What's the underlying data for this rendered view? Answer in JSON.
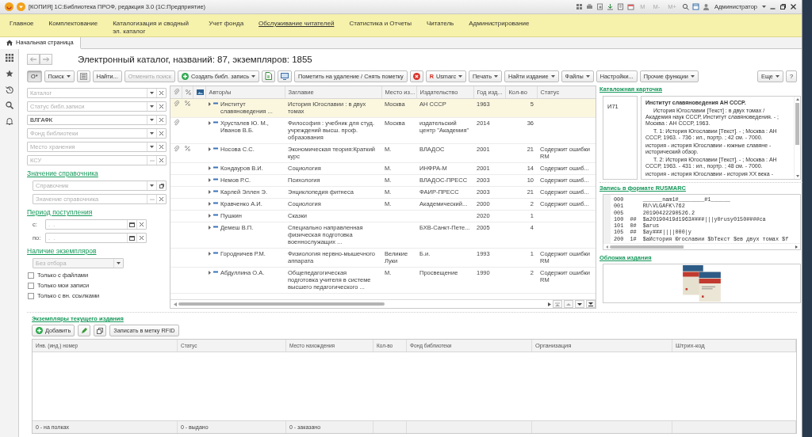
{
  "window": {
    "title": "[КОПИЯ] 1С:Библиотека ПРОФ, редакция 3.0 (1С:Предприятие)",
    "memory_buttons": [
      "M",
      "M-",
      "M+"
    ],
    "user": "Администратор"
  },
  "menu": [
    {
      "label": "Главное",
      "selected": false
    },
    {
      "label": "Комплектование",
      "selected": false
    },
    {
      "label": "Каталогизация и сводный эл. каталог",
      "selected": false
    },
    {
      "label": "Учет фонда",
      "selected": false
    },
    {
      "label": "Обслуживание читателей",
      "selected": true
    },
    {
      "label": "Статистика и Отчеты",
      "selected": false
    },
    {
      "label": "Читатель",
      "selected": false
    },
    {
      "label": "Администрирование",
      "selected": false
    }
  ],
  "tabs": [
    {
      "label": "Начальная страница",
      "selected": true
    }
  ],
  "catalog": {
    "title": "Электронный каталог, названий: 87, экземпляров: 1855"
  },
  "toolbar": [
    {
      "kind": "button",
      "label": "О*",
      "dropdown": false,
      "disabled": false,
      "pressed": true
    },
    {
      "kind": "button",
      "label": "Поиск",
      "dropdown": true,
      "disabled": false,
      "pressed": false
    },
    {
      "kind": "icon"
    },
    {
      "kind": "button",
      "label": "Найти...",
      "dropdown": false,
      "disabled": false,
      "pressed": false
    },
    {
      "kind": "button",
      "label": "Отменить поиск",
      "dropdown": false,
      "disabled": true,
      "pressed": false
    },
    {
      "kind": "create",
      "label": "Создать библ. запись",
      "dropdown": true,
      "disabled": false,
      "pressed": false
    },
    {
      "kind": "icon"
    },
    {
      "kind": "icon"
    },
    {
      "kind": "button",
      "label": "Пометить на удаление / Снять пометку",
      "dropdown": false,
      "disabled": false,
      "pressed": false
    },
    {
      "kind": "icon"
    },
    {
      "kind": "button",
      "badge": "R",
      "label": "Usmarc",
      "dropdown": true,
      "disabled": false,
      "pressed": false
    },
    {
      "kind": "button",
      "label": "Печать",
      "dropdown": true,
      "disabled": false,
      "pressed": false
    },
    {
      "kind": "button",
      "label": "Найти издание",
      "dropdown": true,
      "disabled": false,
      "pressed": false
    },
    {
      "kind": "button",
      "label": "Файлы",
      "dropdown": true,
      "disabled": false,
      "pressed": false
    },
    {
      "kind": "button",
      "label": "Настройки...",
      "dropdown": false,
      "disabled": false,
      "pressed": false
    },
    {
      "kind": "button",
      "label": "Прочие функции",
      "dropdown": true,
      "disabled": false,
      "pressed": false
    }
  ],
  "toolbar_right": [
    {
      "label": "Еще",
      "dropdown": true
    },
    {
      "label": "?",
      "dropdown": false
    }
  ],
  "filters": {
    "fields": [
      {
        "kind": "select",
        "placeholder": "Каталог"
      },
      {
        "kind": "select",
        "placeholder": "Статус библ.записи"
      },
      {
        "kind": "select",
        "value": "ВЛГАФК"
      },
      {
        "kind": "select",
        "placeholder": "Фонд библиотеки"
      },
      {
        "kind": "select",
        "placeholder": "Место хранения"
      },
      {
        "kind": "choice",
        "placeholder": "КСУ"
      }
    ],
    "groups": [
      {
        "title": "Значение справочника",
        "fields": [
          {
            "kind": "reference",
            "placeholder": "Справочник"
          },
          {
            "kind": "choice",
            "placeholder": "Значение справочника"
          }
        ]
      },
      {
        "title": "Период поступления",
        "fields": [
          {
            "kind": "date",
            "label": "с:",
            "placeholder": ".  ."
          },
          {
            "kind": "date",
            "label": "по:",
            "placeholder": ".  ."
          }
        ]
      },
      {
        "title": "Наличие экземпляров",
        "fields": [
          {
            "kind": "dropdown",
            "placeholder": "Без отбора"
          }
        ]
      }
    ],
    "checkboxes": [
      {
        "label": "Только с файлами",
        "checked": false
      },
      {
        "label": "Только мои записи",
        "checked": false
      },
      {
        "label": "Только с вн. ссылками",
        "checked": false
      }
    ]
  },
  "table": {
    "columns": [
      "Автор/ы",
      "Заглавие",
      "Место из...",
      "Издательство",
      "Год изд...",
      "Кол-во",
      "Статус"
    ],
    "rows": [
      {
        "attachment": true,
        "percent": true,
        "author": "Институт славяноведения ...",
        "title": "История Югославии : в двух томах",
        "place": "Москва",
        "publisher": "АН СССР",
        "year": "1963",
        "count": "5",
        "selected": true
      },
      {
        "attachment": true,
        "percent": false,
        "author": "Хрусталев Ю. М., Иванов В.Б.",
        "title": "Философия : учебник для студ. учреждений высш. проф. образования",
        "place": "Москва",
        "publisher": "издательский центр \"Академия\"",
        "year": "2014",
        "count": "36",
        "selected": false
      },
      {
        "attachment": true,
        "percent": true,
        "author": "Носова С.С.",
        "title": "Экономическая теория:Краткий курс",
        "place": "М.",
        "publisher": "ВЛАДОС",
        "year": "2001",
        "count": "21",
        "status": "Содержит ошибки RM",
        "selected": false
      },
      {
        "attachment": false,
        "percent": false,
        "author": "Кондауров В.И.",
        "title": "Социология",
        "place": "М.",
        "publisher": "ИНФРА-М",
        "year": "2001",
        "count": "14",
        "status": "Содержит ошиб...",
        "selected": false
      },
      {
        "attachment": false,
        "percent": false,
        "author": "Немов Р.С.",
        "title": "Психология",
        "place": "М.",
        "publisher": "ВЛАДОС-ПРЕСС",
        "year": "2003",
        "count": "10",
        "status": "Содержит ошиб...",
        "selected": false
      },
      {
        "attachment": false,
        "percent": false,
        "author": "Карлей Эллен Э.",
        "title": "Энциклопедия фитнеса",
        "place": "М.",
        "publisher": "ФАИР-ПРЕСС",
        "year": "2003",
        "count": "21",
        "status": "Содержит ошиб...",
        "selected": false
      },
      {
        "attachment": false,
        "percent": false,
        "author": "Кравченко А.И.",
        "title": "Социология",
        "place": "М.",
        "publisher": "Академический...",
        "year": "2000",
        "count": "2",
        "status": "Содержит ошиб...",
        "selected": false
      },
      {
        "attachment": false,
        "percent": false,
        "author": "Пушкин",
        "title": "Сказки",
        "year": "2020",
        "count": "1",
        "selected": false
      },
      {
        "attachment": false,
        "percent": false,
        "author": "Демеш В.П.",
        "title": "Специально направленная физическая подготовка военнослужащих ...",
        "publisher": "БХВ-Санкт-Пете...",
        "year": "2005",
        "count": "4",
        "selected": false
      },
      {
        "attachment": false,
        "percent": false,
        "author": "Городничев Р.М.",
        "title": "Физиология нервно-мышечного аппарата",
        "place": "Великие Луки",
        "publisher": "Б.и.",
        "year": "1993",
        "count": "1",
        "status": "Содержит ошибки RM",
        "selected": false
      },
      {
        "attachment": false,
        "percent": false,
        "author": "Абдуллина О.А.",
        "title": "Общепедагогическая подготовка учителя в системе высшего педагогического ...",
        "place": "М.",
        "publisher": "Просвещение",
        "year": "1990",
        "count": "2",
        "status": "Содержит ошибки RM",
        "selected": false
      }
    ]
  },
  "details": {
    "card_title": "Каталожная карточка",
    "card": {
      "index": "И71",
      "heading": "Институт славяноведения АН СССР.",
      "paragraphs": [
        {
          "text": "История Югославии [Текст] : в двух томах / Академия наук СССР, Институт славяноведения. - ; Москва : АН СССР, 1963.",
          "indented": true
        },
        {
          "text": "Т. 1: История Югославии [Текст]. - ; Москва : АН СССР, 1963. - 736 : ил., портр. ; 42 см. - 7000.",
          "indented": true
        },
        {
          "text": "история - история Югославии - южные славяне - исторический обзор.",
          "indented": false
        },
        {
          "text": "Т. 2: История Югославии [Текст]. - ; Москва : АН СССР, 1963. - 431 : ил., портр. ; 48 см. - 7000.",
          "indented": true
        },
        {
          "text": "история - история Югославии - история XX века -",
          "indented": false
        }
      ]
    },
    "marc_title": "Запись в формате RUSMARC",
    "marc": [
      {
        "tag": "000",
        "value": "______nam1#________#1______"
      },
      {
        "tag": "001",
        "value": "RU\\VLGAFK\\762"
      },
      {
        "tag": "005",
        "value": "20190422290526.2"
      },
      {
        "tag": "100",
        "indicator": "##",
        "value": "$a20190419d1963####|||y0rusy0150####ca"
      },
      {
        "tag": "101",
        "indicator": "0#",
        "value": "$arus"
      },
      {
        "tag": "105",
        "indicator": "##",
        "value": "$ay###||||000|y"
      },
      {
        "tag": "200",
        "indicator": "1#",
        "value": "$aИстория Югославии $bТекст $eв двух томах $f"
      }
    ],
    "cover_title": "Обложка издания"
  },
  "copies": {
    "title": "Экземпляры текущего издания",
    "toolbar": [
      {
        "kind": "create",
        "label": "Добавить"
      },
      {
        "kind": "icon"
      },
      {
        "kind": "icon"
      },
      {
        "kind": "button",
        "label": "Записать в метку RFID"
      }
    ],
    "columns": [
      "Инв. (инд.) номер",
      "Статус",
      "Место нахождения",
      "Кол-во",
      "Фонд библиотеки",
      "Организация",
      "Штрих-код"
    ],
    "totals": [
      "0 - на полках",
      "0 - выдано",
      "0 - заказано"
    ]
  }
}
